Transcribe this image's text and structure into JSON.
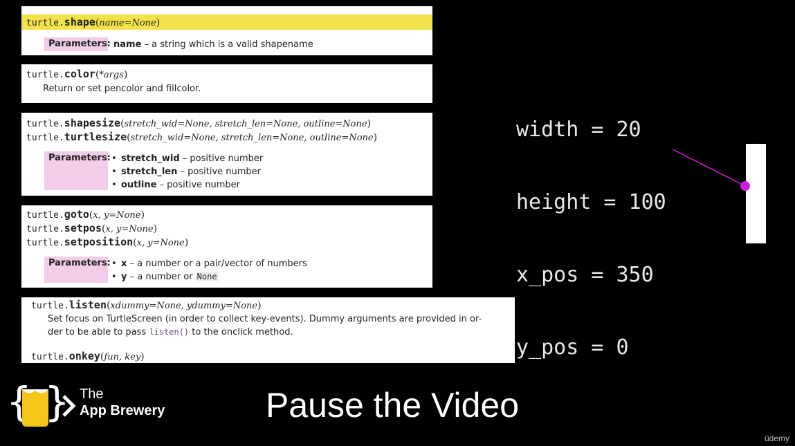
{
  "docs": {
    "shape": {
      "sig": {
        "mod": "turtle.",
        "fn": "shape",
        "args": "name=None"
      },
      "param_label": "Parameters:",
      "param_name": "name",
      "param_desc": " – a string which is a valid shapename"
    },
    "color": {
      "sig": {
        "mod": "turtle.",
        "fn": "color",
        "args": "*args"
      },
      "desc": "Return or set pencolor and fillcolor."
    },
    "shapesize": {
      "sig1": {
        "mod": "turtle.",
        "fn": "shapesize",
        "args": "stretch_wid=None, stretch_len=None, outline=None"
      },
      "sig2": {
        "mod": "turtle.",
        "fn": "turtlesize",
        "args": "stretch_wid=None, stretch_len=None, outline=None"
      },
      "param_label": "Parameters:",
      "params": [
        {
          "name": "stretch_wid",
          "desc": " – positive number"
        },
        {
          "name": "stretch_len",
          "desc": " – positive number"
        },
        {
          "name": "outline",
          "desc": " – positive number"
        }
      ]
    },
    "goto": {
      "sig1": {
        "mod": "turtle.",
        "fn": "goto",
        "args": "x, y=None"
      },
      "sig2": {
        "mod": "turtle.",
        "fn": "setpos",
        "args": "x, y=None"
      },
      "sig3": {
        "mod": "turtle.",
        "fn": "setposition",
        "args": "x, y=None"
      },
      "param_label": "Parameters:",
      "params": [
        {
          "name": "x",
          "desc": " – a number or a pair/vector of numbers"
        },
        {
          "name": "y",
          "desc": " – a number or ",
          "code": "None"
        }
      ]
    },
    "listen": {
      "sig": {
        "mod": "turtle.",
        "fn": "listen",
        "args": "xdummy=None, ydummy=None"
      },
      "desc1": "Set focus on TurtleScreen (in order to collect key-events). Dummy arguments are provided in or-",
      "desc2a": "der to be able to pass ",
      "desc2code": "listen()",
      "desc2b": " to the onclick method.",
      "sig2": {
        "mod": "turtle.",
        "fn": "onkey",
        "args": "fun, key"
      }
    }
  },
  "vars": {
    "line1": "width = 20",
    "line2": "height = 100",
    "line3": "x_pos = 350",
    "line4": "y_pos = 0"
  },
  "logo": {
    "line1": "The",
    "line2": "App Brewery"
  },
  "banner": "Pause the Video",
  "watermark": "ūdemy",
  "colors": {
    "highlight": "#f3e24a",
    "param_bg": "#f1cde9",
    "marker": "#d01ee0"
  }
}
